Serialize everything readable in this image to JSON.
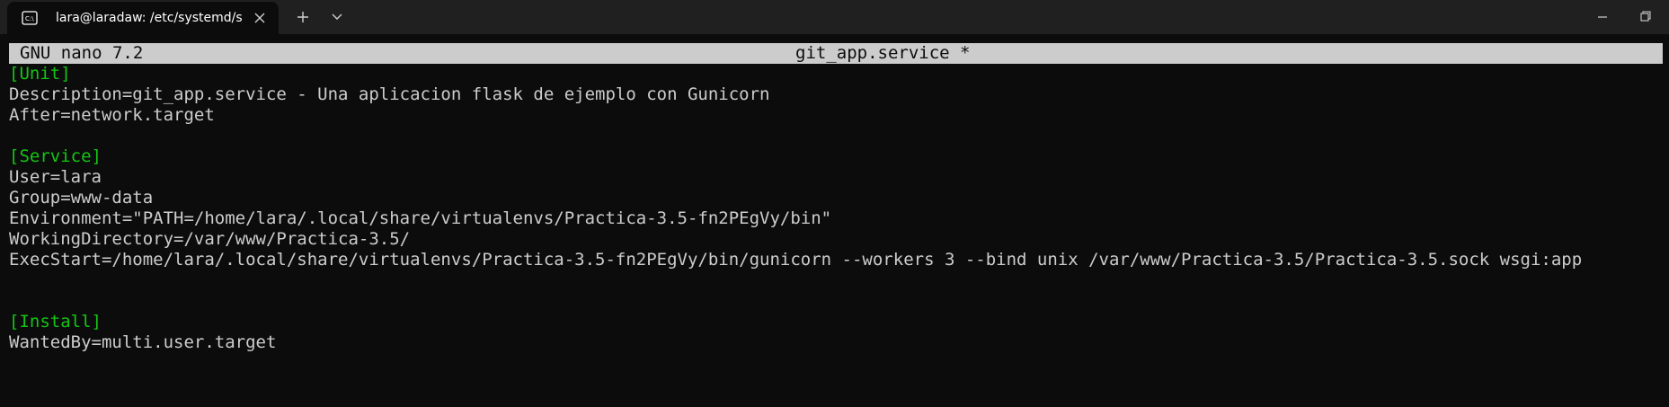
{
  "window": {
    "tab": {
      "title": "lara@laradaw: /etc/systemd/s",
      "icon": "terminal-icon",
      "close_icon": "close-icon"
    },
    "new_tab_icon": "plus-icon",
    "dropdown_icon": "chevron-down-icon",
    "minimize_icon": "minimize-icon",
    "maximize_icon": "restore-icon"
  },
  "colors": {
    "titlebar_bg": "#202020",
    "terminal_bg": "#0c0c0c",
    "text": "#cccccc",
    "section_header": "#13c613",
    "nano_header_bg": "#cccccc"
  },
  "nano": {
    "version": "GNU nano 7.2",
    "filename": "git_app.service *"
  },
  "file_lines": [
    {
      "text": "[Unit]",
      "type": "section"
    },
    {
      "text": "Description=git_app.service - Una aplicacion flask de ejemplo con Gunicorn",
      "type": "text"
    },
    {
      "text": "After=network.target",
      "type": "text"
    },
    {
      "text": "",
      "type": "blank"
    },
    {
      "text": "[Service]",
      "type": "section"
    },
    {
      "text": "User=lara",
      "type": "text"
    },
    {
      "text": "Group=www-data",
      "type": "text"
    },
    {
      "text": "Environment=\"PATH=/home/lara/.local/share/virtualenvs/Practica-3.5-fn2PEgVy/bin\"",
      "type": "text"
    },
    {
      "text": "WorkingDirectory=/var/www/Practica-3.5/",
      "type": "text"
    },
    {
      "text": "ExecStart=/home/lara/.local/share/virtualenvs/Practica-3.5-fn2PEgVy/bin/gunicorn --workers 3 --bind unix /var/www/Practica-3.5/Practica-3.5.sock wsgi:app",
      "type": "text"
    },
    {
      "text": "",
      "type": "blank"
    },
    {
      "text": "",
      "type": "blank"
    },
    {
      "text": "[Install]",
      "type": "section"
    },
    {
      "text": "WantedBy=multi.user.target",
      "type": "text"
    }
  ]
}
